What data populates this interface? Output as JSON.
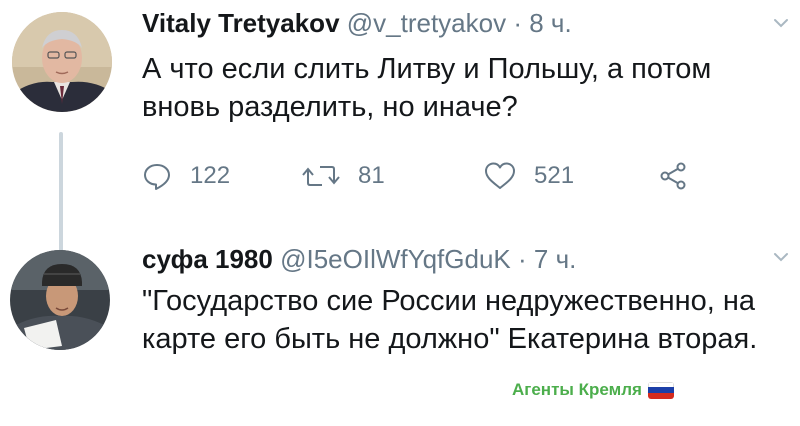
{
  "tweets": [
    {
      "author_name": "Vitaly Tretyakov",
      "handle": "@v_tretyakov",
      "separator": "·",
      "time": "8 ч.",
      "text": "А что если слить Литву и Польшу, а потом вновь разделить, но иначе?",
      "avatar_icon": "profile-photo-older-man",
      "actions": {
        "reply_count": "122",
        "retweet_count": "81",
        "like_count": "521",
        "share_icon": "share-icon"
      }
    },
    {
      "author_name": "суфа 1980",
      "handle": "@I5eOIlWfYqfGduK",
      "separator": "·",
      "time": "7 ч.",
      "text": "\"Государство сие России недружественно, на карте его быть не должно\" Екатерина вторая.",
      "avatar_icon": "profile-photo-man-with-hat"
    }
  ],
  "watermark": {
    "text": "Агенты Кремля",
    "flag_icon": "russian-flag-icon",
    "color": "#4cae4c"
  },
  "colors": {
    "text": "#14171a",
    "muted": "#657786",
    "thread_line": "#ccd6dd"
  }
}
